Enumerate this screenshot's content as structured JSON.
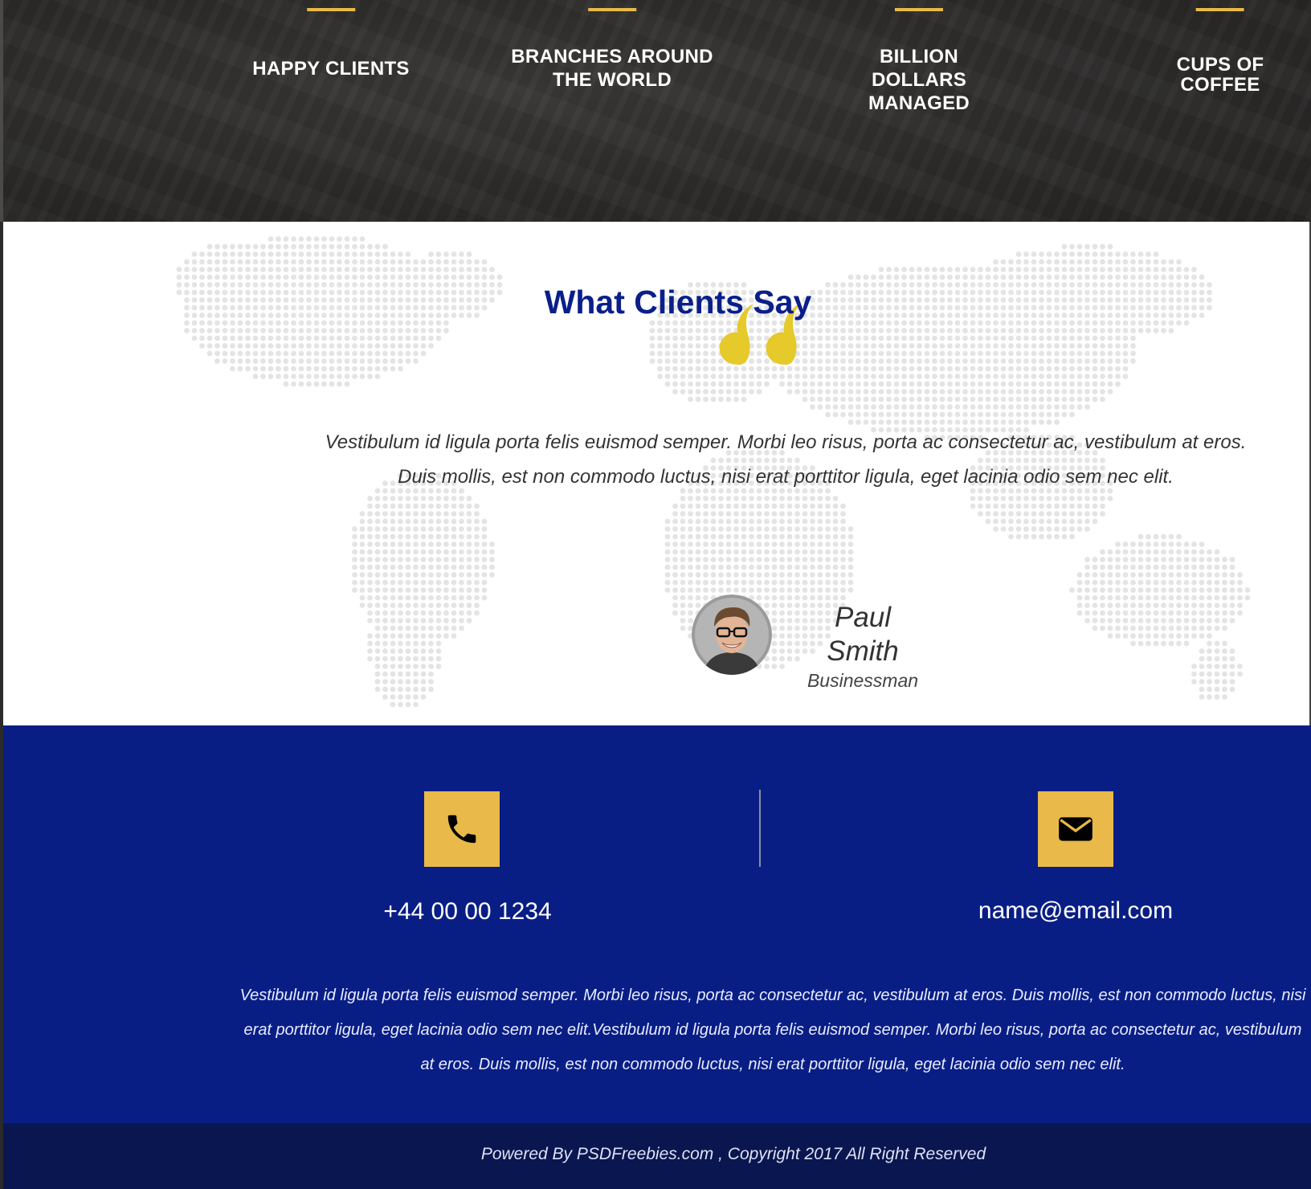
{
  "stats": {
    "items": [
      {
        "label": "HAPPY CLIENTS",
        "icon": "gold-bar"
      },
      {
        "label": "BRANCHES AROUND\nTHE WORLD",
        "icon": "gold-bar"
      },
      {
        "label": "BILLION\nDOLLARS\nMANAGED",
        "icon": "gold-bar"
      },
      {
        "label": "CUPS OF\nCOFFEE",
        "icon": "gold-bar"
      }
    ]
  },
  "testimonial": {
    "title": "What Clients Say",
    "quote_icon": "quote-icon",
    "text": "Vestibulum id ligula porta felis euismod semper. Morbi leo risus, porta ac consectetur ac, vestibulum at eros. Duis mollis, est non commodo luctus, nisi erat porttitor ligula, eget lacinia odio sem nec elit.",
    "person": {
      "name": "Paul\nSmith",
      "role": "Businessman"
    }
  },
  "contact": {
    "phone_icon": "phone-icon",
    "phone": "+44 00 00 1234",
    "email_icon": "envelope-icon",
    "email": "name@email.com",
    "text": "Vestibulum id ligula porta felis euismod semper. Morbi leo risus, porta ac consectetur ac, vestibulum at eros. Duis mollis, est non commodo luctus, nisi erat porttitor ligula, eget lacinia odio sem nec elit.Vestibulum id ligula porta felis euismod semper. Morbi leo risus, porta ac consectetur ac, vestibulum at eros. Duis mollis, est non commodo luctus, nisi erat porttitor ligula, eget lacinia odio sem nec elit."
  },
  "footer": {
    "text": "Powered By PSDFreebies.com , Copyright 2017 All Right Reserved"
  },
  "colors": {
    "accent": "#e9b949",
    "title_blue": "#0a1f8a",
    "contact_bg": "#091e85",
    "footer_bg": "#0a1650",
    "stats_bg": "#2c2b2a"
  }
}
